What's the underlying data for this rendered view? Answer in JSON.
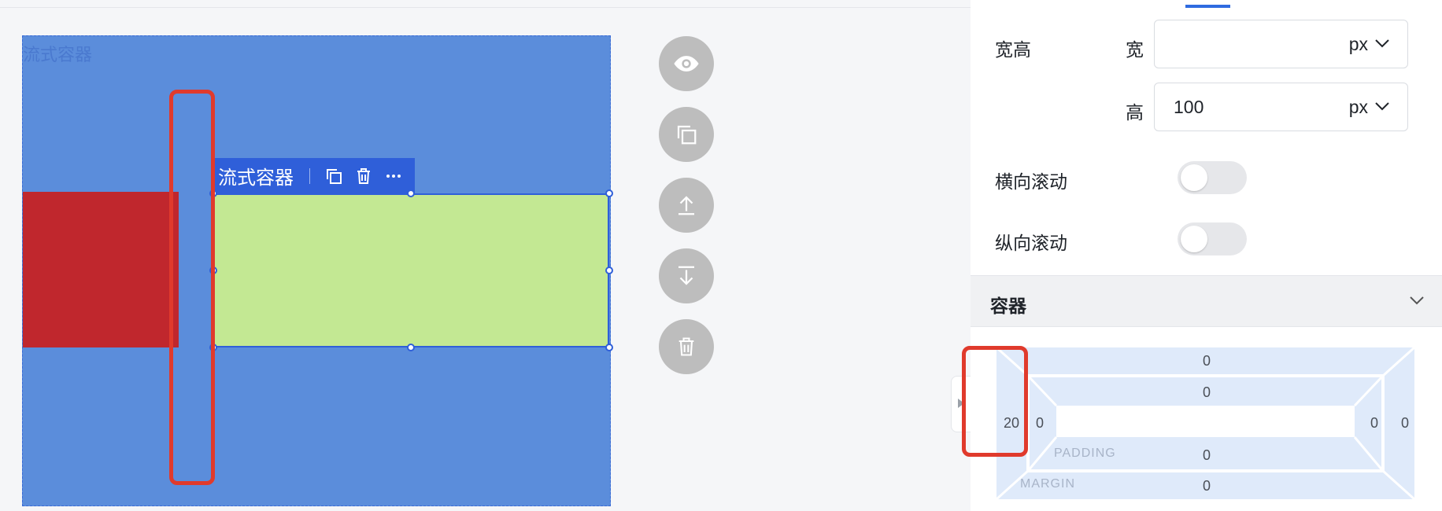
{
  "canvas": {
    "container_label": "流式容器",
    "toolbar": {
      "label": "流式容器",
      "copy_icon": "copy-icon",
      "delete_icon": "trash-icon",
      "more_icon": "more-icon"
    },
    "colors": {
      "container_bg": "#5b8ddb",
      "red_block": "#c0272d",
      "green_block": "#c3e893",
      "selection": "#2f5fd9",
      "highlight": "#e03a2c"
    }
  },
  "fabs": [
    {
      "name": "preview-button",
      "icon": "eye-icon"
    },
    {
      "name": "duplicate-button",
      "icon": "copy-icon"
    },
    {
      "name": "move-up-button",
      "icon": "move-up-icon"
    },
    {
      "name": "move-down-button",
      "icon": "move-down-icon"
    },
    {
      "name": "delete-button",
      "icon": "trash-icon"
    }
  ],
  "panel": {
    "size_label": "宽高",
    "width": {
      "label": "宽",
      "value": "",
      "unit": "px"
    },
    "height": {
      "label": "高",
      "value": "100",
      "unit": "px"
    },
    "scroll_x": {
      "label": "横向滚动",
      "enabled": false
    },
    "scroll_y": {
      "label": "纵向滚动",
      "enabled": false
    },
    "container_section": {
      "title": "容器"
    },
    "box_model": {
      "margin": {
        "top": "0",
        "right": "0",
        "bottom": "0",
        "left": "20",
        "caption": "MARGIN"
      },
      "padding": {
        "top": "0",
        "right": "0",
        "bottom": "0",
        "left": "0",
        "caption": "PADDING"
      }
    }
  }
}
